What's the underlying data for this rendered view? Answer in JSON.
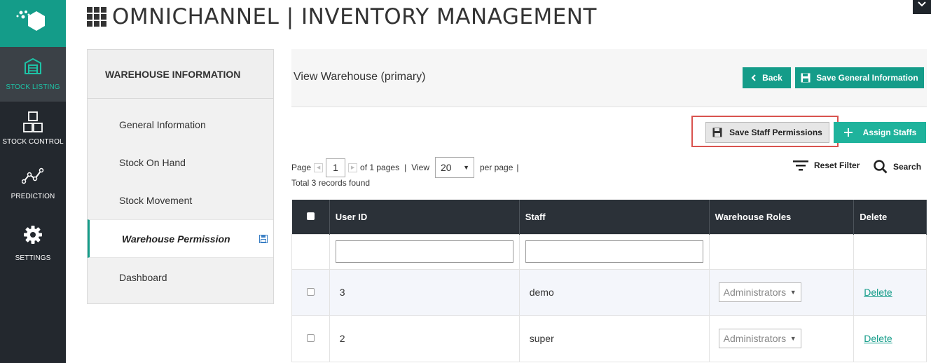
{
  "nav": {
    "items": [
      {
        "label": "STOCK LISTING",
        "icon": "warehouse-icon"
      },
      {
        "label": "STOCK CONTROL",
        "icon": "boxes-icon"
      },
      {
        "label": "PREDICTION",
        "icon": "trend-line-icon"
      },
      {
        "label": "SETTINGS",
        "icon": "gear-icon"
      }
    ]
  },
  "header": {
    "title": "OMNICHANNEL | INVENTORY MANAGEMENT"
  },
  "sidepanel": {
    "heading": "WAREHOUSE INFORMATION",
    "items": [
      {
        "label": "General Information"
      },
      {
        "label": "Stock On Hand"
      },
      {
        "label": "Stock Movement"
      },
      {
        "label": "Warehouse Permission"
      },
      {
        "label": "Dashboard"
      }
    ]
  },
  "main": {
    "title": "View Warehouse (primary)",
    "back_label": "Back",
    "save_general_label": "Save General Information",
    "save_staff_label": "Save Staff Permissions",
    "assign_label": "Assign Staffs",
    "accent_color": "#149c89",
    "highlight_color": "#d9534f"
  },
  "pager": {
    "page_label": "Page",
    "page_value": "1",
    "of_pages": "of 1 pages",
    "separator": "|",
    "view_label": "View",
    "view_value": "20",
    "per_page": "per page",
    "total": "Total 3 records found"
  },
  "tools": {
    "reset_filter": "Reset Filter",
    "search": "Search"
  },
  "table": {
    "columns": [
      "User ID",
      "Staff",
      "Warehouse Roles",
      "Delete"
    ],
    "rows": [
      {
        "user_id": "3",
        "staff": "demo",
        "role": "Administrators",
        "delete": "Delete"
      },
      {
        "user_id": "2",
        "staff": "super",
        "role": "Administrators",
        "delete": "Delete"
      }
    ]
  }
}
